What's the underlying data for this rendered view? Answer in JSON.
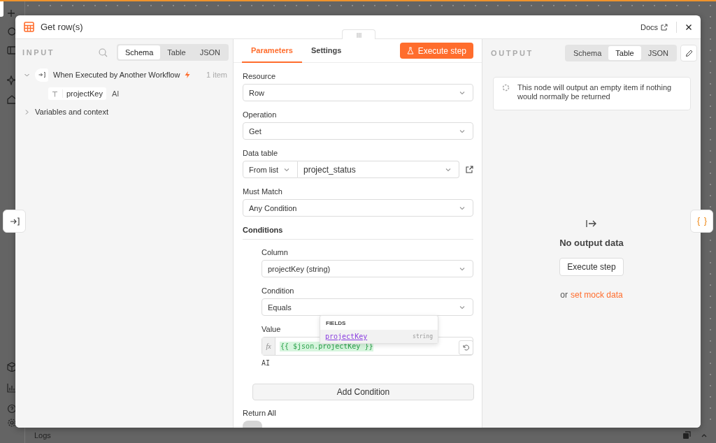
{
  "app": {
    "logs_label": "Logs"
  },
  "modal": {
    "title": "Get row(s)",
    "docs_link": "Docs"
  },
  "input_panel": {
    "heading": "INPUT",
    "view_tabs": [
      {
        "label": "Schema",
        "selected": true
      },
      {
        "label": "Table",
        "selected": false
      },
      {
        "label": "JSON",
        "selected": false
      }
    ],
    "tree": [
      {
        "kind": "node",
        "label": "When Executed by Another Workflow",
        "count": "1 item",
        "expanded": true,
        "children": [
          {
            "kind": "field",
            "label": "projectKey",
            "suffix": "AI"
          }
        ]
      },
      {
        "kind": "section",
        "label": "Variables and context",
        "expanded": false
      }
    ]
  },
  "parameters_panel": {
    "tabs": [
      {
        "label": "Parameters",
        "selected": true
      },
      {
        "label": "Settings",
        "selected": false
      }
    ],
    "execute_button": "Execute step",
    "fields": [
      {
        "label": "Resource",
        "value": "Row"
      },
      {
        "label": "Operation",
        "value": "Get"
      }
    ],
    "data_table": {
      "label": "Data table",
      "mode": "From list",
      "value": "project_status"
    },
    "must_match": {
      "label": "Must Match",
      "value": "Any Condition"
    },
    "conditions": {
      "heading": "Conditions",
      "column": {
        "label": "Column",
        "value": "projectKey (string)"
      },
      "condition": {
        "label": "Condition",
        "value": "Equals"
      },
      "value": {
        "label": "Value",
        "fx_label": "fx",
        "expression": "{{ $json.projectKey }}",
        "note": "AI"
      },
      "add_button": "Add Condition"
    },
    "return_all": {
      "label": "Return All",
      "on": false
    }
  },
  "autocomplete": {
    "heading": "FIELDS",
    "items": [
      {
        "name": "projectKey",
        "type": "string",
        "selected": true
      }
    ]
  },
  "output_panel": {
    "heading": "OUTPUT",
    "view_tabs": [
      {
        "label": "Schema",
        "selected": false
      },
      {
        "label": "Table",
        "selected": true
      },
      {
        "label": "JSON",
        "selected": false
      }
    ],
    "notice": "This node will output an empty item if nothing would normally be returned",
    "empty_title": "No output data",
    "execute_button": "Execute step",
    "mock_prefix": "or",
    "mock_link": "set mock data"
  }
}
